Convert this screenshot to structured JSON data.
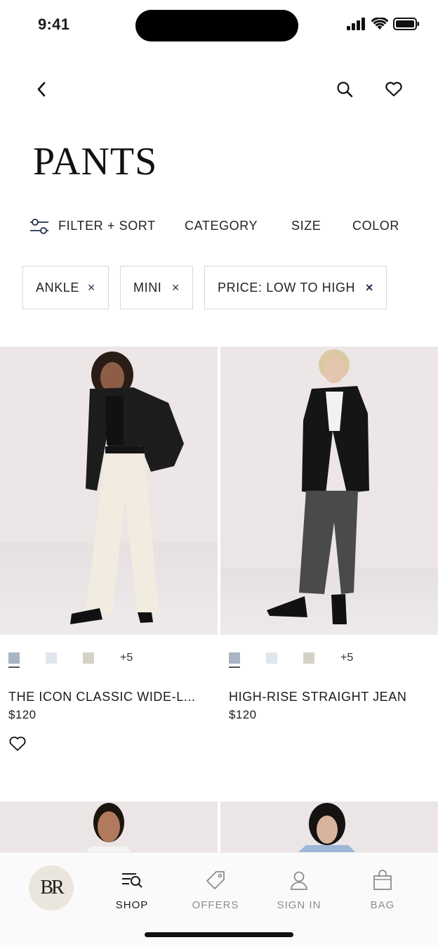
{
  "status_bar": {
    "time": "9:41"
  },
  "header": {
    "title": "PANTS"
  },
  "filters": {
    "filter_sort": "FILTER + SORT",
    "category": "CATEGORY",
    "size": "SIZE",
    "color": "COLOR"
  },
  "chips": [
    {
      "label": "ANKLE",
      "remove": "×"
    },
    {
      "label": "MINI",
      "remove": "×"
    },
    {
      "label": "PRICE: LOW TO HIGH",
      "remove": "×"
    }
  ],
  "products": [
    {
      "name": "THE ICON CLASSIC WIDE-L...",
      "price": "$120",
      "more_colors": "+5",
      "swatches": [
        "#a9b4c4",
        "#dfe6ee",
        "#d4d2c8"
      ]
    },
    {
      "name": "HIGH-RISE STRAIGHT JEAN",
      "price": "$120",
      "more_colors": "+5",
      "swatches": [
        "#a9b4c4",
        "#dfe6ee",
        "#d4d2c8"
      ]
    }
  ],
  "tabbar": {
    "logo": "BR",
    "tabs": [
      {
        "label": "SHOP",
        "icon": "shop-search-icon",
        "active": true
      },
      {
        "label": "OFFERS",
        "icon": "tag-icon",
        "active": false
      },
      {
        "label": "SIGN IN",
        "icon": "person-icon",
        "active": false
      },
      {
        "label": "BAG",
        "icon": "bag-icon",
        "active": false
      }
    ]
  },
  "colors": {
    "accent_navy": "#1e3050",
    "logo_bg": "#ebe6dd",
    "photo_bg": "#ece6e7"
  }
}
